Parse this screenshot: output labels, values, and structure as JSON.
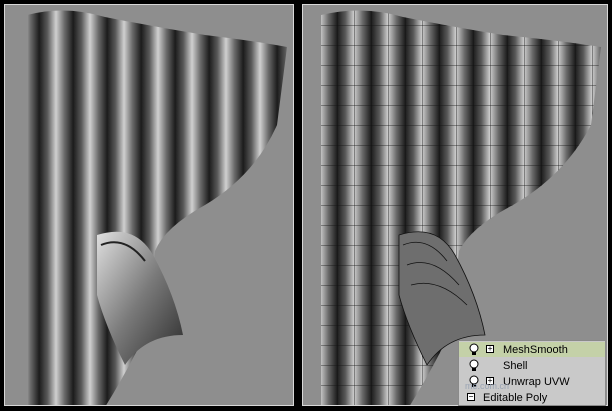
{
  "viewports": [
    {
      "mode": "smooth-shaded"
    },
    {
      "mode": "wireframe-on-shaded"
    }
  ],
  "modifier_stack": {
    "items": [
      {
        "label": "MeshSmooth",
        "has_expand": true,
        "selected": true
      },
      {
        "label": "Shell",
        "has_expand": false,
        "selected": false
      },
      {
        "label": "Unwrap UVW",
        "has_expand": true,
        "selected": false
      }
    ],
    "base_object": {
      "label": "Editable Poly",
      "expand_symbol": "−"
    }
  },
  "watermark": "me.com.cn",
  "colors": {
    "viewport_bg": "#8e8e8e",
    "stack_selected": "#c4d1a8",
    "separator": "#000000"
  }
}
